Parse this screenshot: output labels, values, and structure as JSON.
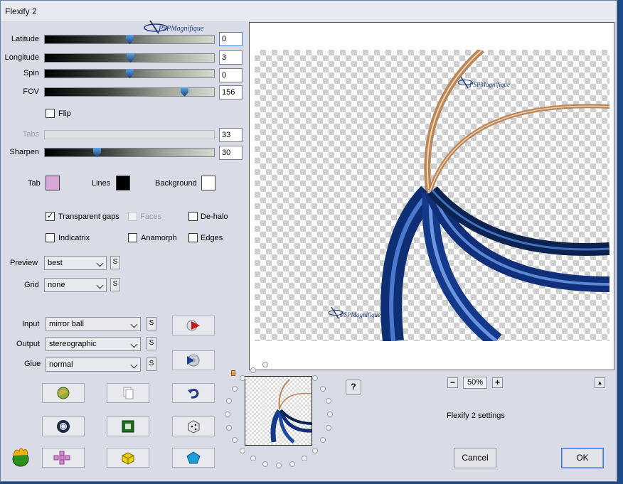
{
  "window": {
    "title": "Flexify 2"
  },
  "sliders": {
    "latitude": {
      "label": "Latitude",
      "value": "0",
      "fraction": 0.5
    },
    "longitude": {
      "label": "Longitude",
      "value": "3",
      "fraction": 0.505
    },
    "spin": {
      "label": "Spin",
      "value": "0",
      "fraction": 0.5
    },
    "fov": {
      "label": "FOV",
      "value": "156",
      "fraction": 0.84
    },
    "tabs": {
      "label": "Tabs",
      "value": "33",
      "fraction": 0.0
    },
    "sharpen": {
      "label": "Sharpen",
      "value": "30",
      "fraction": 0.3
    }
  },
  "flip": {
    "label": "Flip",
    "checked": false
  },
  "colors": {
    "tab": {
      "label": "Tab",
      "color": "#d8a8d8"
    },
    "lines": {
      "label": "Lines",
      "color": "#000000"
    },
    "background": {
      "label": "Background",
      "color": "#ffffff"
    }
  },
  "options": {
    "transparent_gaps": {
      "label": "Transparent gaps",
      "checked": true
    },
    "faces": {
      "label": "Faces",
      "checked": false
    },
    "de_halo": {
      "label": "De-halo",
      "checked": false
    },
    "indicatrix": {
      "label": "Indicatrix",
      "checked": false
    },
    "anamorph": {
      "label": "Anamorph",
      "checked": false
    },
    "edges": {
      "label": "Edges",
      "checked": false
    }
  },
  "preview": {
    "label": "Preview",
    "value": "best",
    "s": "S"
  },
  "grid": {
    "label": "Grid",
    "value": "none",
    "s": "S"
  },
  "input": {
    "label": "Input",
    "value": "mirror ball",
    "s": "S"
  },
  "output": {
    "label": "Output",
    "value": "stereographic",
    "s": "S"
  },
  "glue": {
    "label": "Glue",
    "value": "normal",
    "s": "S"
  },
  "watermark": {
    "text": "PSPMagnifique"
  },
  "zoom": {
    "minus": "−",
    "value": "50%",
    "plus": "+"
  },
  "up_arrow": "▲",
  "help": "?",
  "settings_label": "Flexify 2 settings",
  "buttons": {
    "cancel": "Cancel",
    "ok": "OK"
  },
  "colors_ui": {
    "accent": "#3d7bd5",
    "ribbon_blue": "#1a3f8f",
    "ribbon_copper": "#b88a5e"
  }
}
